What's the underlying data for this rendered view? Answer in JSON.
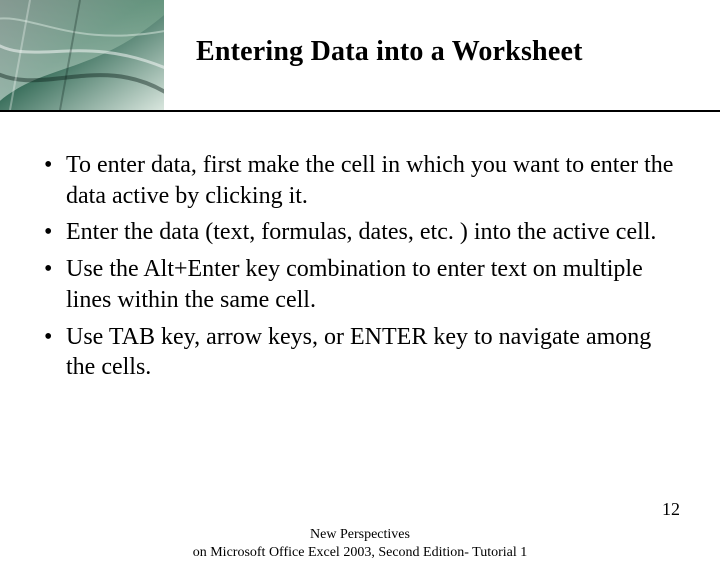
{
  "title": "Entering Data into a Worksheet",
  "bullets": [
    "To enter data, first make the cell in which you want to enter the data active by clicking it.",
    "Enter the data (text, formulas, dates, etc. ) into the active cell.",
    "Use the Alt+Enter key combination to enter text on multiple lines within the same cell.",
    "Use TAB key, arrow keys, or ENTER key to navigate among the cells."
  ],
  "footer": {
    "line1": "New Perspectives",
    "line2": "on Microsoft Office Excel 2003, Second Edition- Tutorial 1"
  },
  "page_number": "12"
}
